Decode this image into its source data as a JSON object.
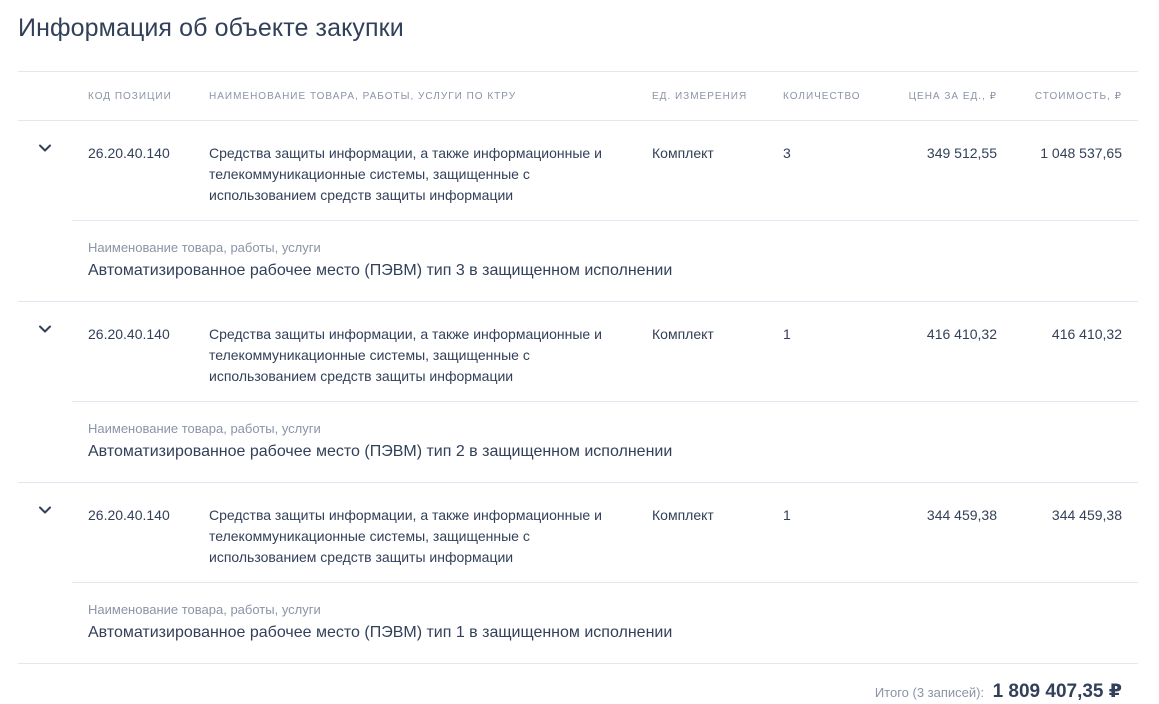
{
  "page": {
    "title": "Информация об объекте закупки"
  },
  "table": {
    "headers": {
      "code": "КОД ПОЗИЦИИ",
      "name": "НАИМЕНОВАНИЕ ТОВАРА, РАБОТЫ, УСЛУГИ ПО КТРУ",
      "unit": "ЕД. ИЗМЕРЕНИЯ",
      "qty": "КОЛИЧЕСТВО",
      "price": "ЦЕНА ЗА ЕД., ₽",
      "cost": "СТОИМОСТЬ, ₽"
    },
    "rows": [
      {
        "code": "26.20.40.140",
        "name": "Средства защиты информации, а также информационные и телекоммуникационные системы, защищенные с использованием средств защиты информации",
        "unit": "Комплект",
        "qty": "3",
        "price": "349 512,55",
        "cost": "1 048 537,65",
        "detail_label": "Наименование товара, работы, услуги",
        "detail_value": "Автоматизированное рабочее место (ПЭВМ) тип 3 в защищенном исполнении"
      },
      {
        "code": "26.20.40.140",
        "name": "Средства защиты информации, а также информационные и телекоммуникационные системы, защищенные с использованием средств защиты информации",
        "unit": "Комплект",
        "qty": "1",
        "price": "416 410,32",
        "cost": "416 410,32",
        "detail_label": "Наименование товара, работы, услуги",
        "detail_value": "Автоматизированное рабочее место (ПЭВМ) тип 2 в защищенном исполнении"
      },
      {
        "code": "26.20.40.140",
        "name": "Средства защиты информации, а также информационные и телекоммуникационные системы, защищенные с использованием средств защиты информации",
        "unit": "Комплект",
        "qty": "1",
        "price": "344 459,38",
        "cost": "344 459,38",
        "detail_label": "Наименование товара, работы, услуги",
        "detail_value": "Автоматизированное рабочее место (ПЭВМ) тип 1 в защищенном исполнении"
      }
    ]
  },
  "total": {
    "label": "Итого (3 записей):",
    "value": "1 809 407,35 ₽"
  },
  "icons": {
    "row_toggle": "chevron-down-icon"
  },
  "colors": {
    "text": "#334059",
    "muted": "#8a94a6",
    "divider": "#e4e7f2"
  }
}
